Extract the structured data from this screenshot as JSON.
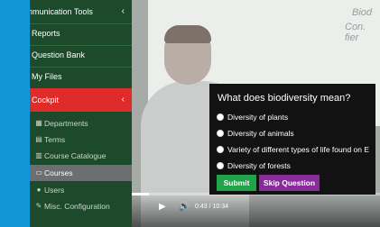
{
  "sidebar": {
    "top_item": "nmunication Tools",
    "items": [
      {
        "label": "Reports"
      },
      {
        "label": "Question Bank"
      },
      {
        "label": "My Files"
      },
      {
        "label": "Cockpit",
        "active": true
      }
    ],
    "sub_items": [
      {
        "label": "Departments",
        "icon": "building-icon"
      },
      {
        "label": "Terms",
        "icon": "calendar-icon"
      },
      {
        "label": "Course Catalogue",
        "icon": "book-icon"
      },
      {
        "label": "Courses",
        "icon": "folder-icon",
        "selected": true
      },
      {
        "label": "Users",
        "icon": "user-icon"
      },
      {
        "label": "Misc. Configuration",
        "icon": "wrench-icon"
      }
    ],
    "colors": {
      "background": "#1e4a2c",
      "active": "#e02b2b",
      "selected": "#6b6f72"
    }
  },
  "video": {
    "time": "0:43 / 10:34",
    "progress": 0.07,
    "whiteboard_text": [
      "Biod",
      "Con. fier"
    ]
  },
  "quiz": {
    "question": "What does biodiversity mean?",
    "options": [
      "Diversity of plants",
      "Diversity of animals",
      "Variety of different types of life found on E",
      "Diversity of forests"
    ],
    "submit_label": "Submit",
    "skip_label": "Skip Question",
    "colors": {
      "submit": "#21a34a",
      "skip": "#8a2b9c"
    }
  }
}
